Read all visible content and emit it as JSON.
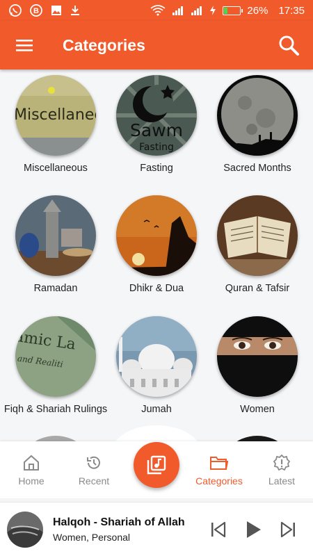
{
  "status_bar": {
    "battery_percent": "26%",
    "battery_level": 0.26,
    "time": "17:35",
    "icons": [
      "whatsapp-icon",
      "b-notification-icon",
      "image-icon",
      "download-icon",
      "wifi-icon",
      "signal-icon",
      "signal-icon",
      "charging-icon",
      "battery-icon"
    ]
  },
  "app_bar": {
    "title": "Categories",
    "menu_icon": "hamburger-icon",
    "search_icon": "search-icon"
  },
  "categories": [
    {
      "label": "Miscellaneous",
      "image_text": "Miscellaneou"
    },
    {
      "label": "Fasting",
      "image_text": "Sawm",
      "image_subtext": "Fasting"
    },
    {
      "label": "Sacred Months"
    },
    {
      "label": "Ramadan"
    },
    {
      "label": "Dhikr & Dua"
    },
    {
      "label": "Quran & Tafsir"
    },
    {
      "label": "Fiqh & Shariah Rulings",
      "image_text": "amic La",
      "image_subtext": "and Realiti"
    },
    {
      "label": "Jumah"
    },
    {
      "label": "Women"
    }
  ],
  "bottom_nav": {
    "items": [
      {
        "label": "Home",
        "icon": "home-icon",
        "active": false
      },
      {
        "label": "Recent",
        "icon": "history-icon",
        "active": false
      },
      {
        "label": "Categories",
        "icon": "folder-icon",
        "active": true
      },
      {
        "label": "Latest",
        "icon": "badge-alert-icon",
        "active": false
      }
    ],
    "fab_icon": "music-library-icon"
  },
  "player": {
    "title": "Halqoh - Shariah of Allah",
    "subtitle": "Women, Personal",
    "controls": [
      "skip-previous-icon",
      "play-icon",
      "skip-next-icon"
    ]
  },
  "colors": {
    "accent": "#f15a2b",
    "background": "#f5f6f8",
    "battery_fill": "#4cd84c"
  }
}
